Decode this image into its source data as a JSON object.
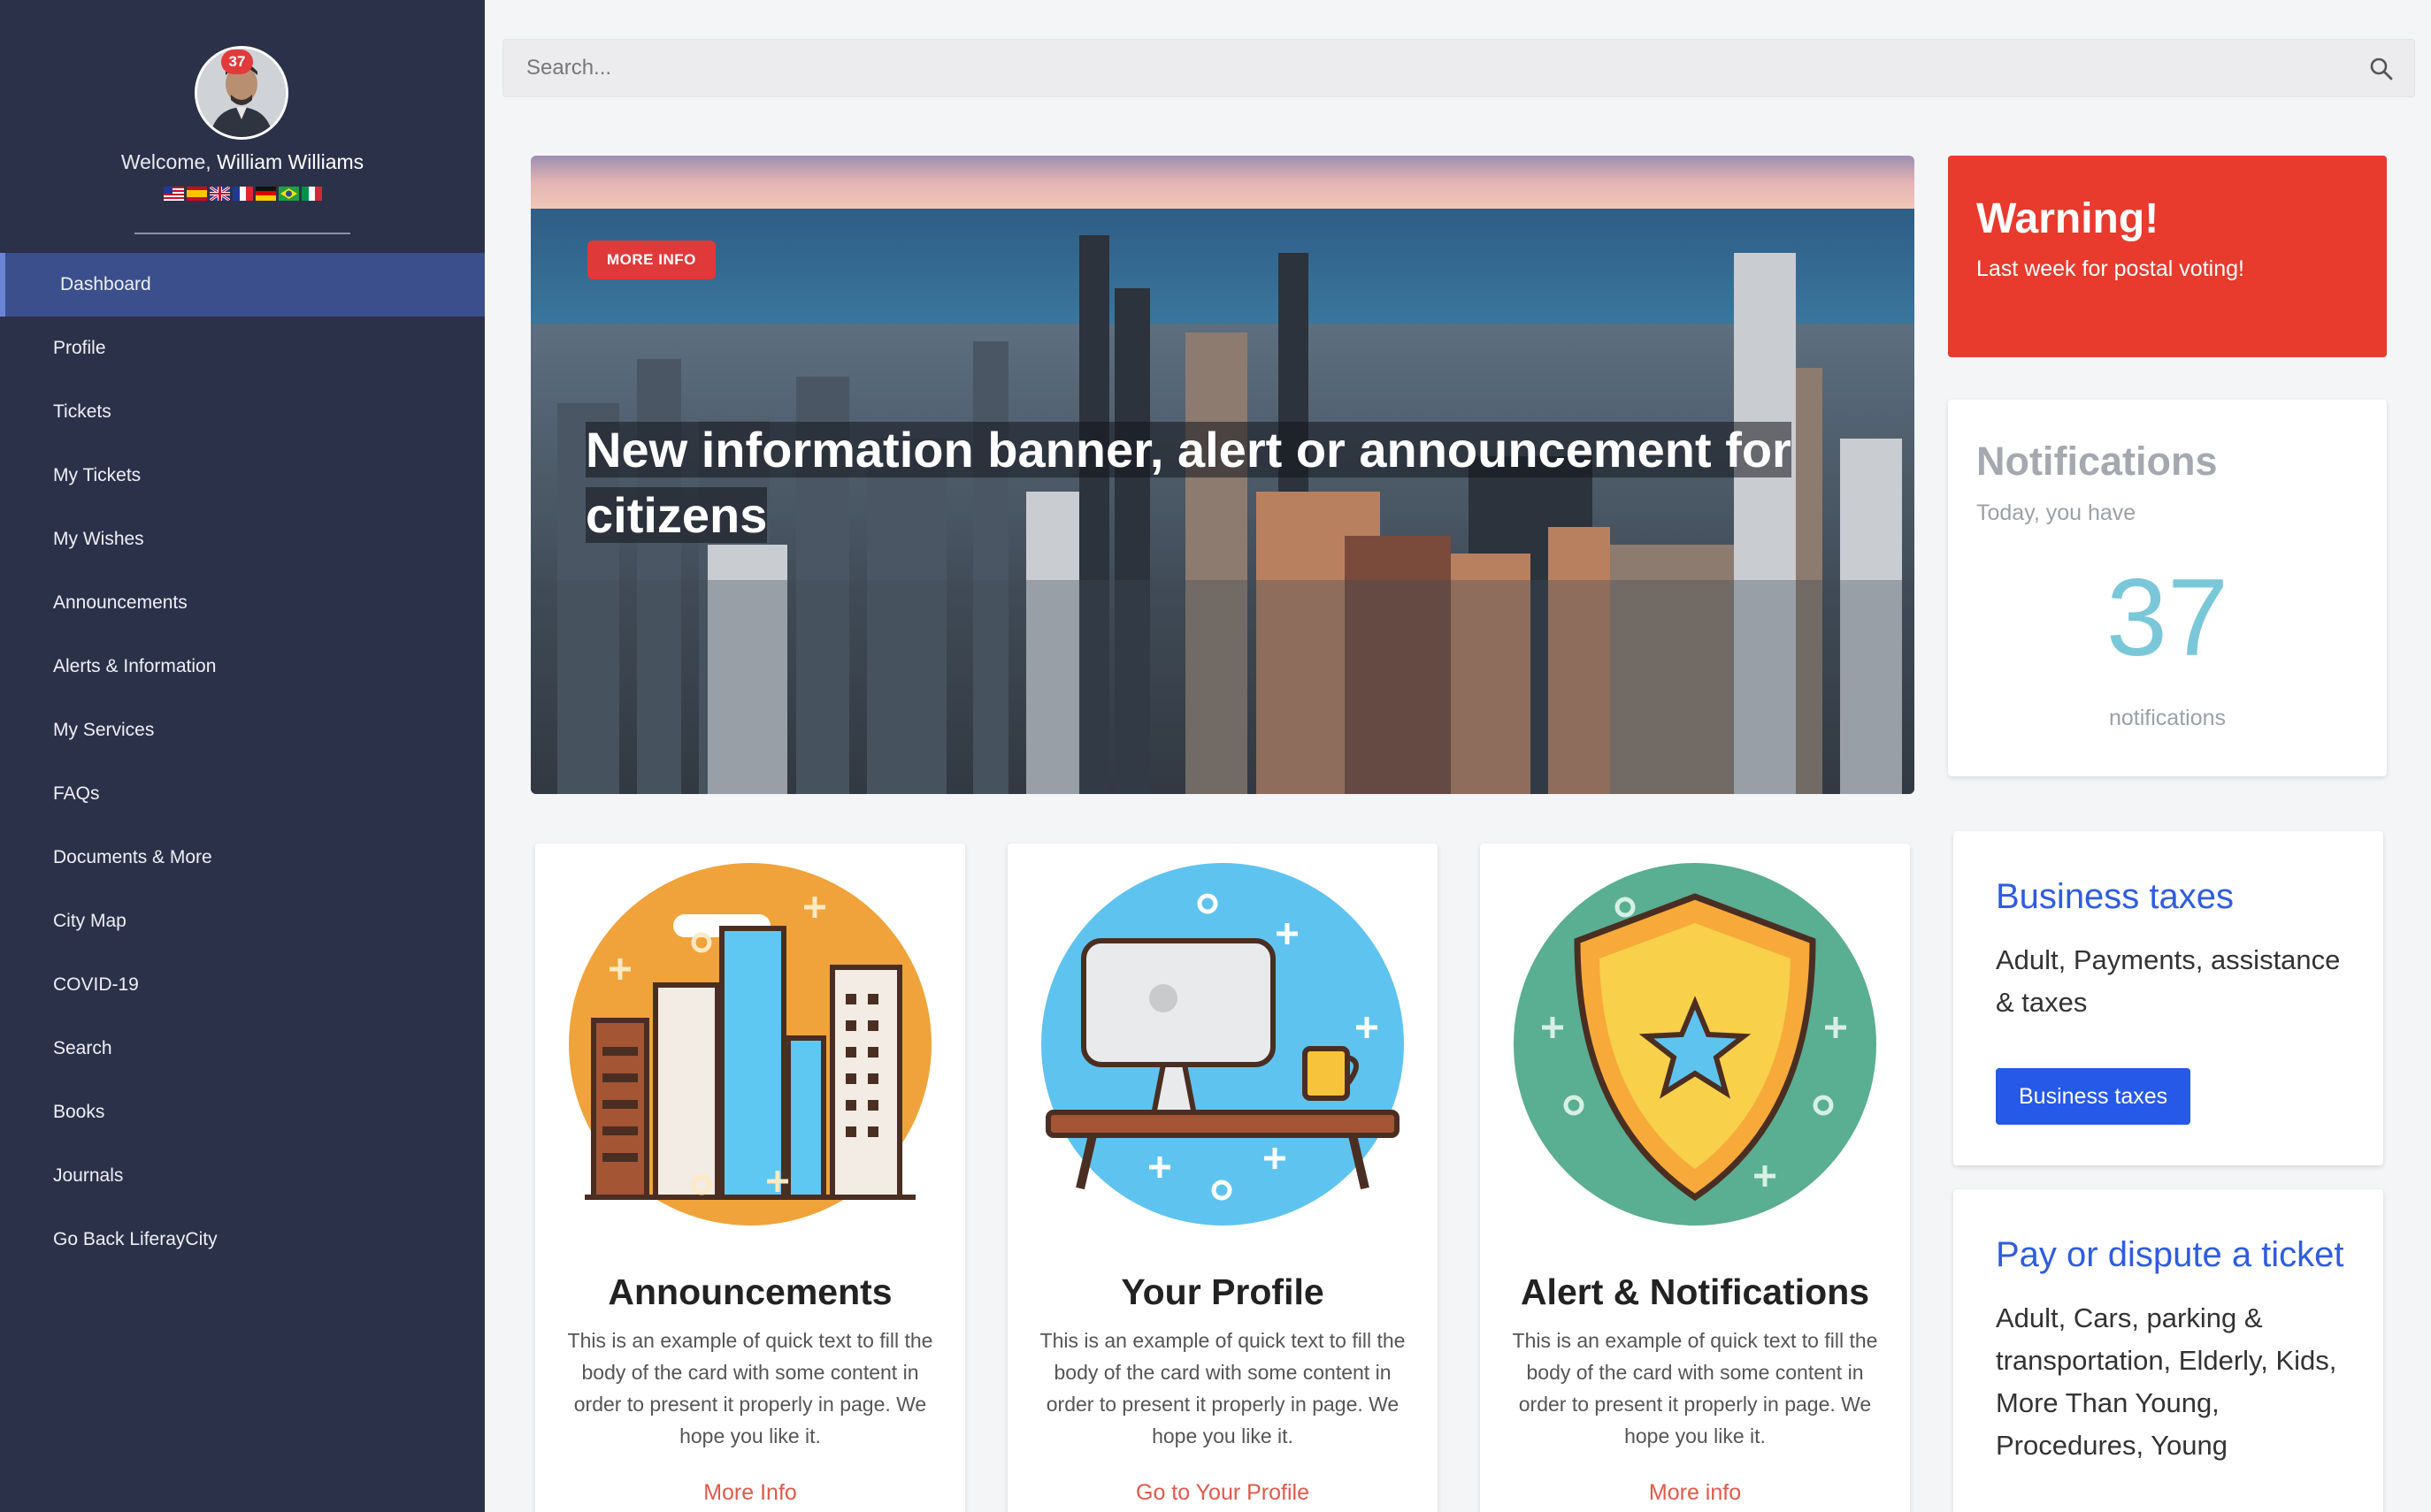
{
  "sidebar": {
    "badge_count": "37",
    "welcome_prefix": "Welcome,",
    "user_name": "William Williams",
    "items": [
      {
        "label": "Dashboard",
        "active": true
      },
      {
        "label": "Profile"
      },
      {
        "label": "Tickets"
      },
      {
        "label": "My Tickets"
      },
      {
        "label": "My Wishes"
      },
      {
        "label": "Announcements"
      },
      {
        "label": "Alerts & Information"
      },
      {
        "label": "My Services"
      },
      {
        "label": "FAQs"
      },
      {
        "label": "Documents & More"
      },
      {
        "label": "City Map"
      },
      {
        "label": "COVID-19"
      },
      {
        "label": "Search"
      },
      {
        "label": "Books"
      },
      {
        "label": "Journals"
      },
      {
        "label": "Go Back LiferayCity"
      }
    ],
    "flags": [
      "us-flag",
      "es-flag",
      "uk-flag",
      "fr-flag",
      "de-flag",
      "br-flag",
      "it-flag"
    ]
  },
  "search": {
    "placeholder": "Search..."
  },
  "hero": {
    "badge": "MORE INFO",
    "title": "New information banner, alert or announcement for citizens"
  },
  "warning": {
    "title": "Warning!",
    "text": "Last week for postal voting!"
  },
  "notifications": {
    "title": "Notifications",
    "subtitle": "Today, you have",
    "count": "37",
    "label": "notifications"
  },
  "cards": [
    {
      "title": "Announcements",
      "body": "This is an example of quick text to fill the body of the card with some content in order to present it properly in page. We hope you like it.",
      "link": "More Info"
    },
    {
      "title": "Your Profile",
      "body": "This is an example of quick text to fill the body of the card with some content in order to present it properly in page. We hope you like it.",
      "link": "Go to Your Profile"
    },
    {
      "title": "Alert & Notifications",
      "body": "This is an example of quick text to fill the body of the card with some content in order to present it properly in page. We hope you like it.",
      "link": "More info"
    }
  ],
  "info_cards": [
    {
      "title": "Business taxes",
      "text": "Adult, Payments, assistance & taxes",
      "button": "Business taxes"
    },
    {
      "title": "Pay or dispute a ticket",
      "text": "Adult, Cars, parking & transportation, Elderly, Kids, More Than Young, Procedures, Young"
    }
  ],
  "colors": {
    "sidebar_bg": "#2b3149",
    "active_item": "#3a4f8c",
    "warning": "#e83a2d",
    "accent_blue": "#2659e8",
    "link_red": "#e2584a",
    "count_teal": "#7ac7d9"
  }
}
